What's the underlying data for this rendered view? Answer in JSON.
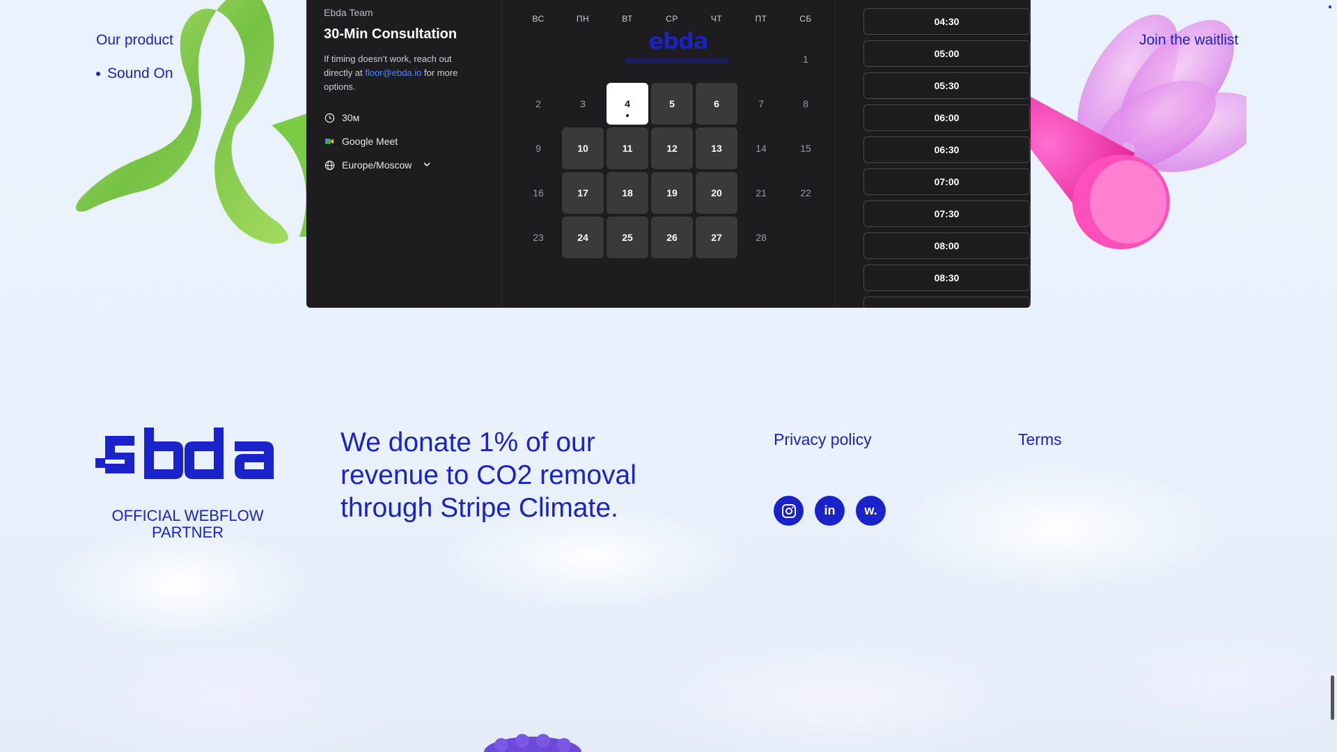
{
  "nav": {
    "product": "Our product",
    "list_items": [
      {
        "label": "Sound On"
      }
    ],
    "waitlist": "Join the waitlist"
  },
  "booking": {
    "team": "Ebda Team",
    "title": "30-Min Consultation",
    "note_before": "If timing doesn’t work, reach out directly at ",
    "email": "floor@ebda.io",
    "note_after": " for more options.",
    "duration": "30м",
    "meeting_app": "Google Meet",
    "timezone": "Europe/Moscow",
    "weekdays": [
      "ВС",
      "ПН",
      "ВТ",
      "СР",
      "ЧТ",
      "ПТ",
      "СБ"
    ],
    "days": [
      {
        "d": "",
        "s": "empty"
      },
      {
        "d": "",
        "s": "empty"
      },
      {
        "d": "",
        "s": "empty"
      },
      {
        "d": "",
        "s": "empty"
      },
      {
        "d": "",
        "s": "empty"
      },
      {
        "d": "",
        "s": "empty"
      },
      {
        "d": "1",
        "s": "off"
      },
      {
        "d": "2",
        "s": "off"
      },
      {
        "d": "3",
        "s": "off"
      },
      {
        "d": "4",
        "s": "selected"
      },
      {
        "d": "5",
        "s": "available"
      },
      {
        "d": "6",
        "s": "available"
      },
      {
        "d": "7",
        "s": "off"
      },
      {
        "d": "8",
        "s": "off"
      },
      {
        "d": "9",
        "s": "off"
      },
      {
        "d": "10",
        "s": "available"
      },
      {
        "d": "11",
        "s": "available"
      },
      {
        "d": "12",
        "s": "available"
      },
      {
        "d": "13",
        "s": "available"
      },
      {
        "d": "14",
        "s": "off"
      },
      {
        "d": "15",
        "s": "off"
      },
      {
        "d": "16",
        "s": "off"
      },
      {
        "d": "17",
        "s": "available"
      },
      {
        "d": "18",
        "s": "available"
      },
      {
        "d": "19",
        "s": "available"
      },
      {
        "d": "20",
        "s": "available"
      },
      {
        "d": "21",
        "s": "off"
      },
      {
        "d": "22",
        "s": "off"
      },
      {
        "d": "23",
        "s": "off"
      },
      {
        "d": "24",
        "s": "available"
      },
      {
        "d": "25",
        "s": "available"
      },
      {
        "d": "26",
        "s": "available"
      },
      {
        "d": "27",
        "s": "available"
      },
      {
        "d": "28",
        "s": "off"
      },
      {
        "d": "",
        "s": "empty"
      }
    ],
    "time_slots": [
      "04:30",
      "05:00",
      "05:30",
      "06:00",
      "06:30",
      "07:00",
      "07:30",
      "08:00",
      "08:30"
    ]
  },
  "footer": {
    "partner": "OFFICIAL WEBFLOW PARTNER",
    "donate": "We donate 1% of our revenue to CO2 removal through Stripe Climate.",
    "privacy": "Privacy policy",
    "terms": "Terms",
    "socials": [
      {
        "name": "instagram-icon",
        "glyph": ""
      },
      {
        "name": "linkedin-icon",
        "glyph": "in"
      },
      {
        "name": "webflow-icon",
        "glyph": "w."
      }
    ]
  },
  "colors": {
    "brand_blue": "#1a23c9",
    "widget_bg": "#1d1d1f",
    "day_available": "#3a3a3d"
  }
}
